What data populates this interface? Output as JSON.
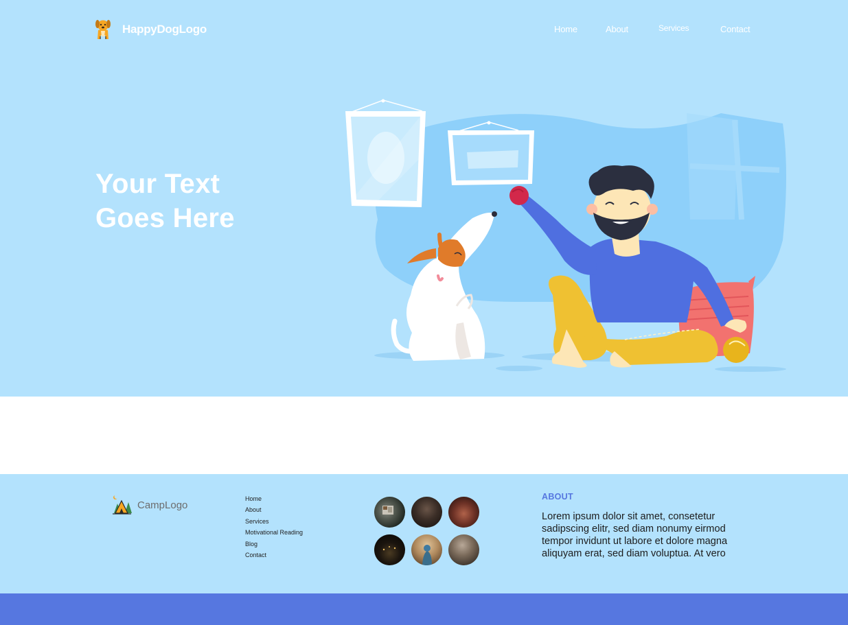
{
  "header": {
    "brand_name": "HappyDogLogo",
    "brand_icon": "dog-icon",
    "nav": [
      {
        "label": "Home"
      },
      {
        "label": "About"
      },
      {
        "label": "Services"
      },
      {
        "label": "Contact"
      }
    ]
  },
  "hero": {
    "title_line1": "Your Text",
    "title_line2": "Goes Here"
  },
  "footer": {
    "brand_name": "CampLogo",
    "brand_icon": "campsite-icon",
    "links": [
      "Home",
      "About",
      "Services",
      "Motivational Reading",
      "Blog",
      "Contact"
    ],
    "gallery_count": 6,
    "about_heading": "ABOUT",
    "about_text": "Lorem ipsum dolor sit amet, consetetur sadipscing elitr, sed diam nonumy eirmod tempor invidunt ut labore et dolore magna aliquyam erat, sed diam voluptua. At vero"
  },
  "colors": {
    "hero_bg": "#b3e2fd",
    "footer_bg": "#b3e2fd",
    "accent": "#5677e0",
    "white": "#ffffff"
  }
}
